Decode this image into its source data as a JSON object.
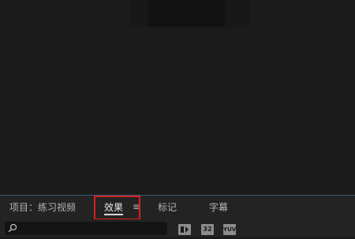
{
  "panel": {
    "tabs": [
      {
        "label": "项目：练习视频",
        "active": false
      },
      {
        "label": "效果",
        "active": true
      },
      {
        "label": "标记",
        "active": false
      },
      {
        "label": "字幕",
        "active": false
      }
    ],
    "menu_icon": "hamburger-icon"
  },
  "search": {
    "value": "",
    "placeholder": "",
    "icon": "search-icon"
  },
  "filters": [
    {
      "label": "",
      "icon": "accelerated-effects-icon"
    },
    {
      "label": "32",
      "icon": "32-bit-color-icon"
    },
    {
      "label": "YUV",
      "icon": "yuv-effects-icon"
    }
  ],
  "colors": {
    "background": "#1b1b1b",
    "panel": "#232323",
    "highlight": "#d42020",
    "divider": "#3a5b7a"
  }
}
